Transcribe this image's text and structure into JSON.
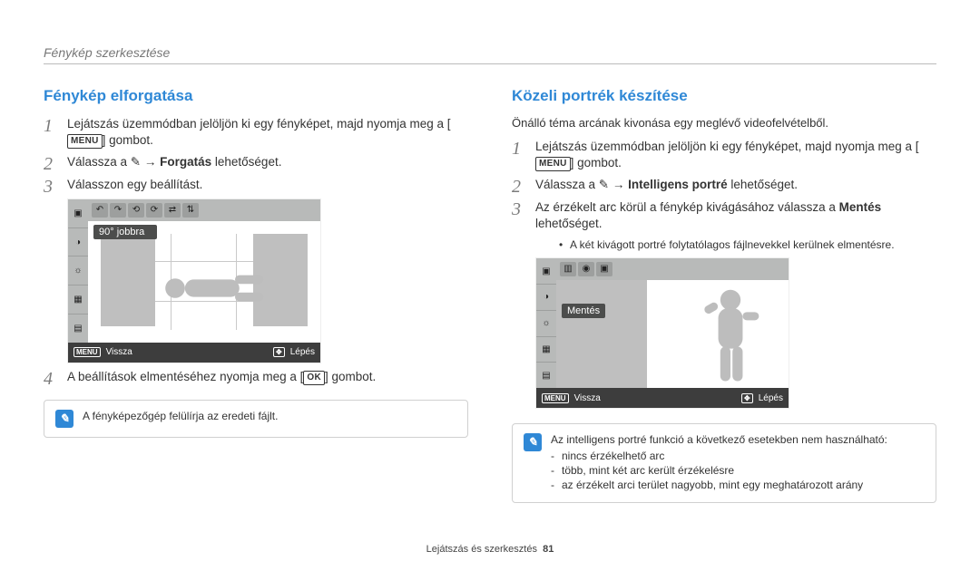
{
  "header_title": "Fénykép szerkesztése",
  "left": {
    "heading": "Fénykép elforgatása",
    "step1_a": "Lejátszás üzemmódban jelöljön ki egy fényképet, majd nyomja meg a [",
    "step1_menu": "MENU",
    "step1_b": "] gombot.",
    "step2_a": "Válassza a ",
    "step2_icon": "✎",
    "step2_b": " → ",
    "step2_bold": "Forgatás",
    "step2_c": " lehetőséget.",
    "step3": "Válasszon egy beállítást.",
    "lcd_dropdown": "90° jobbra",
    "lcd_back_label": "Vissza",
    "lcd_move_label": "Lépés",
    "step4_a": "A beállítások elmentéséhez nyomja meg a [",
    "step4_ok": "OK",
    "step4_b": "] gombot.",
    "note": "A fényképezőgép felülírja az eredeti fájlt."
  },
  "right": {
    "heading": "Közeli portrék készítése",
    "intro": "Önálló téma arcának kivonása egy meglévő videofelvételből.",
    "step1_a": "Lejátszás üzemmódban jelöljön ki egy fényképet, majd nyomja meg a [",
    "step1_menu": "MENU",
    "step1_b": "] gombot.",
    "step2_a": "Válassza a ",
    "step2_icon": "✎",
    "step2_b": " → ",
    "step2_bold": "Intelligens portré",
    "step2_c": " lehetőséget.",
    "step3_a": "Az érzékelt arc körül a fénykép kivágásához válassza a ",
    "step3_bold": "Mentés",
    "step3_b": " lehetőséget.",
    "bullet1": "A két kivágott portré folytatólagos fájlnevekkel kerülnek elmentésre.",
    "lcd_dropdown": "Mentés",
    "lcd_back_label": "Vissza",
    "lcd_move_label": "Lépés",
    "note_head": "Az intelligens portré funkció a következő esetekben nem használható:",
    "note_items": {
      "i0": "nincs érzékelhető arc",
      "i1": "több, mint két arc került érzékelésre",
      "i2": "az érzékelt arci terület nagyobb, mint egy meghatározott arány"
    }
  },
  "footer_text": "Lejátszás és szerkesztés",
  "footer_page": "81",
  "icons": {
    "note": "✎",
    "cross": "✦"
  }
}
